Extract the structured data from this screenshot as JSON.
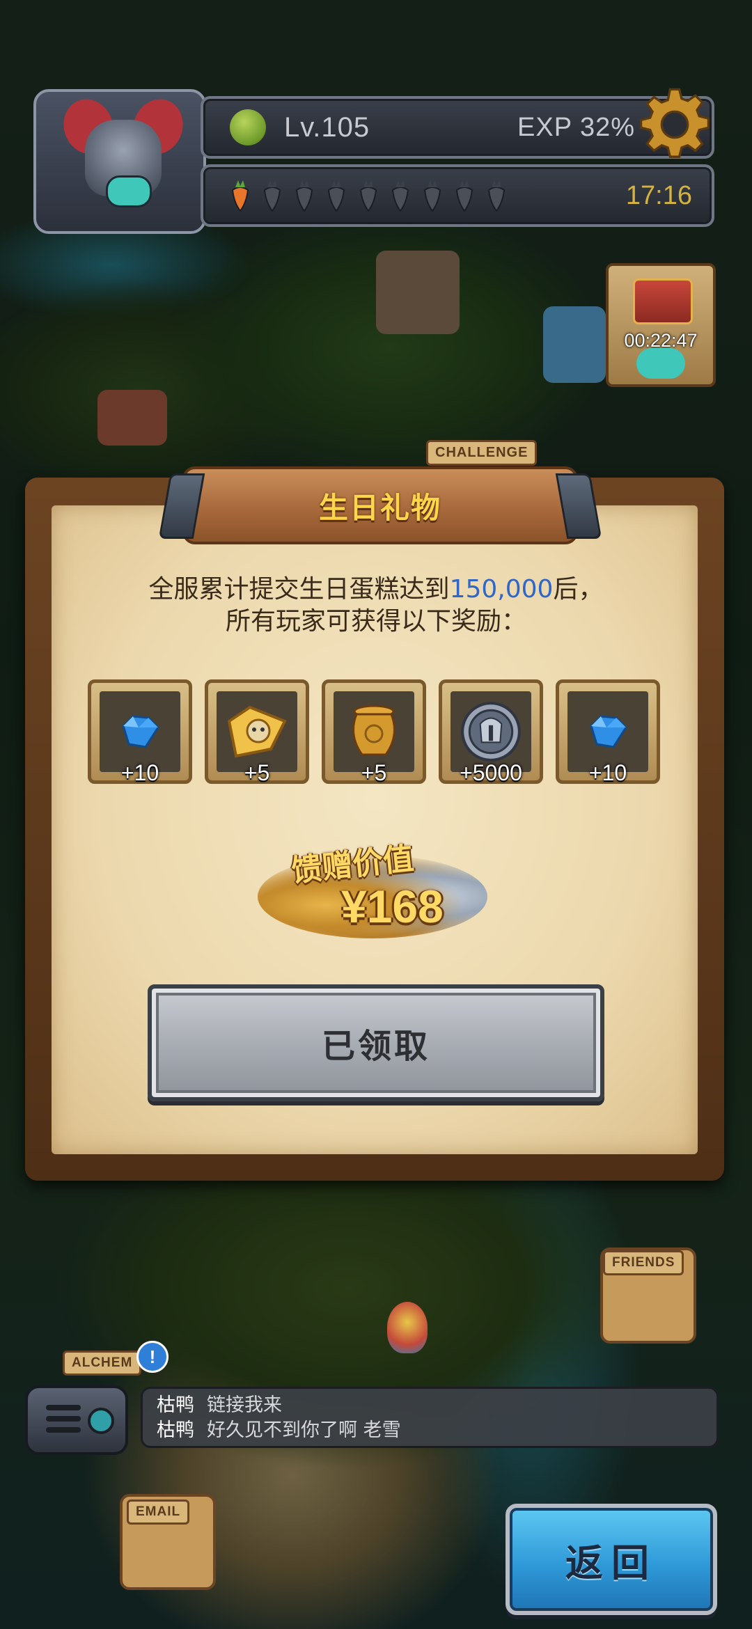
{
  "hud": {
    "level": "Lv.105",
    "exp": "EXP 32%",
    "timer": "17:16",
    "carrot_count_total": 9,
    "carrot_count_filled": 1,
    "chest_timer": "00:22:47"
  },
  "map_labels": {
    "challenge": "CHALLENGE",
    "friends": "FRIENDS",
    "alchemy": "ALCHEM",
    "email": "EMAIL"
  },
  "dialog": {
    "title": "生日礼物",
    "desc_line1_a": "全服累计提交生日蛋糕达到",
    "desc_line1_highlight": "150,000",
    "desc_line1_b": "后，",
    "desc_line2": "所有玩家可获得以下奖励：",
    "rewards": [
      {
        "icon": "blue-gem-icon",
        "qty": "+10"
      },
      {
        "icon": "puzzle-piece-icon",
        "qty": "+5"
      },
      {
        "icon": "golden-pot-icon",
        "qty": "+5"
      },
      {
        "icon": "silver-coin-icon",
        "qty": "+5000"
      },
      {
        "icon": "blue-gem-icon",
        "qty": "+10"
      }
    ],
    "value_label": "馈赠价值",
    "value_amount": "¥168",
    "claimed_button": "已领取"
  },
  "chat": {
    "messages": [
      {
        "user": "枯鸭",
        "text": "链接我来"
      },
      {
        "user": "枯鸭",
        "text": "好久见不到你了啊 老雪"
      }
    ]
  },
  "alert_badge": "!",
  "back_button": "返回",
  "colors": {
    "highlight_blue": "#2f66c8",
    "title_gold": "#ffd54a",
    "back_button_blue": "#2f9ad8"
  }
}
